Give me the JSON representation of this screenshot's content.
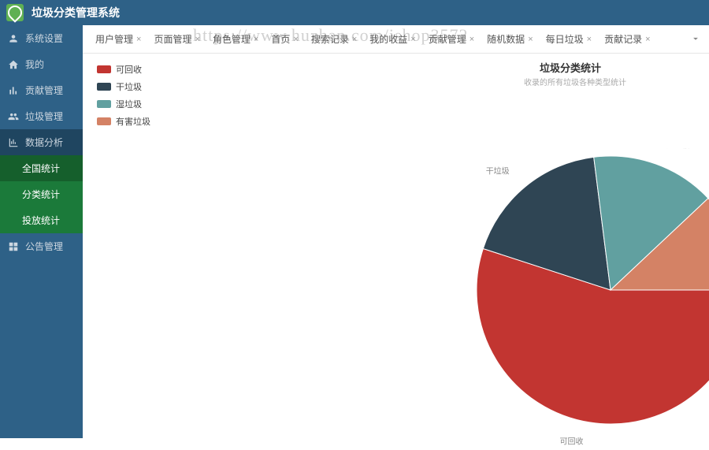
{
  "header": {
    "title": "垃圾分类管理系统"
  },
  "sidebar": {
    "items": [
      {
        "label": "系统设置",
        "icon": "user"
      },
      {
        "label": "我的",
        "icon": "home"
      },
      {
        "label": "贡献管理",
        "icon": "bars"
      },
      {
        "label": "垃圾管理",
        "icon": "group"
      },
      {
        "label": "数据分析",
        "icon": "chart",
        "active": true
      },
      {
        "label": "公告管理",
        "icon": "grid"
      }
    ],
    "sub": [
      {
        "label": "全国统计",
        "active": true
      },
      {
        "label": "分类统计"
      },
      {
        "label": "投放统计"
      }
    ]
  },
  "tabs": {
    "items": [
      {
        "label": "用户管理"
      },
      {
        "label": "页面管理"
      },
      {
        "label": "角色管理"
      },
      {
        "label": "首页"
      },
      {
        "label": "搜索记录"
      },
      {
        "label": "我的收益"
      },
      {
        "label": "贡献管理"
      },
      {
        "label": "随机数据"
      },
      {
        "label": "每日垃圾"
      },
      {
        "label": "贡献记录"
      }
    ]
  },
  "chart_data": {
    "type": "pie",
    "title": "垃圾分类统计",
    "subtitle": "收录的所有垃圾各种类型统计",
    "series": [
      {
        "name": "可回收",
        "value": 55,
        "color": "#c23531"
      },
      {
        "name": "干垃圾",
        "value": 18,
        "color": "#2f4554"
      },
      {
        "name": "湿垃圾",
        "value": 15,
        "color": "#61a0a0"
      },
      {
        "name": "有害垃圾",
        "value": 12,
        "color": "#d48265"
      }
    ]
  },
  "watermark": "https://www.huzhan.com/ishop3572"
}
